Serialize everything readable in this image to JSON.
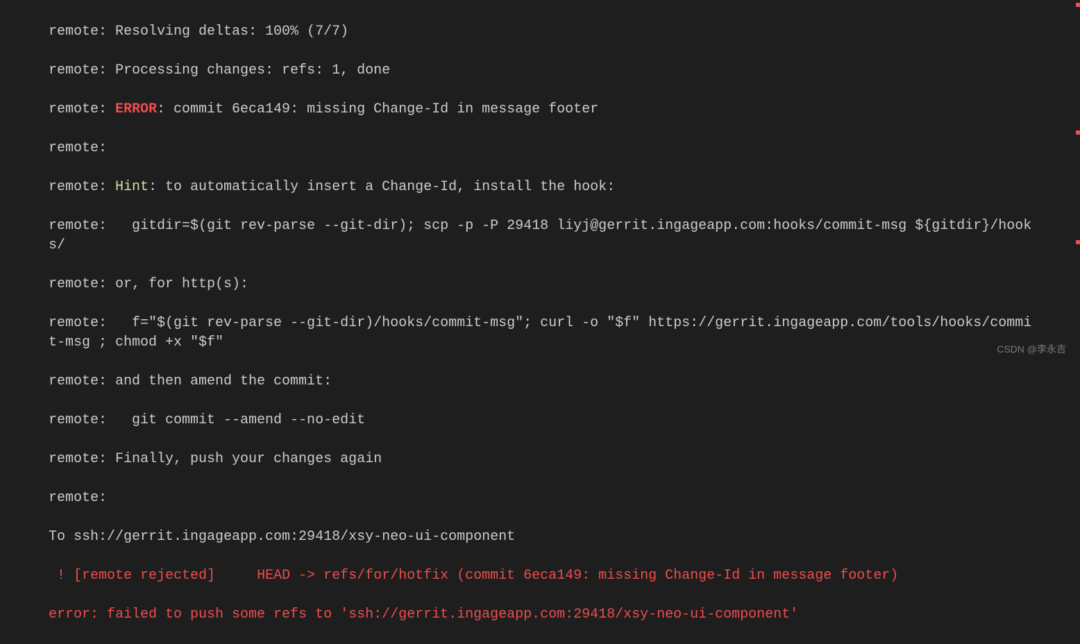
{
  "lines": {
    "l1": "remote: Resolving deltas: 100% (7/7)",
    "l2": "remote: Processing changes: refs: 1, done",
    "l3a": "remote: ",
    "l3err": "ERROR",
    "l3b": ": commit 6eca149: missing Change-Id in message footer",
    "l4": "remote:",
    "l5a": "remote: ",
    "l5hint": "Hint",
    "l5b": ": to automatically insert a Change-Id, install the hook:",
    "l6": "remote:   gitdir=$(git rev-parse --git-dir); scp -p -P 29418 liyj@gerrit.ingageapp.com:hooks/commit-msg ${gitdir}/hooks/",
    "l7": "remote: or, for http(s):",
    "l8": "remote:   f=\"$(git rev-parse --git-dir)/hooks/commit-msg\"; curl -o \"$f\" https://gerrit.ingageapp.com/tools/hooks/commit-msg ; chmod +x \"$f\"",
    "l9": "remote: and then amend the commit:",
    "l10": "remote:   git commit --amend --no-edit",
    "l11": "remote: Finally, push your changes again",
    "l12": "remote:",
    "l13": "To ssh://gerrit.ingageapp.com:29418/xsy-neo-ui-component",
    "l14": " ! [remote rejected]     HEAD -> refs/for/hotfix (commit 6eca149: missing Change-Id in message footer)",
    "l15": "error: failed to push some refs to 'ssh://gerrit.ingageapp.com:29418/xsy-neo-ui-component'"
  },
  "watermark": "CSDN @李永吉"
}
